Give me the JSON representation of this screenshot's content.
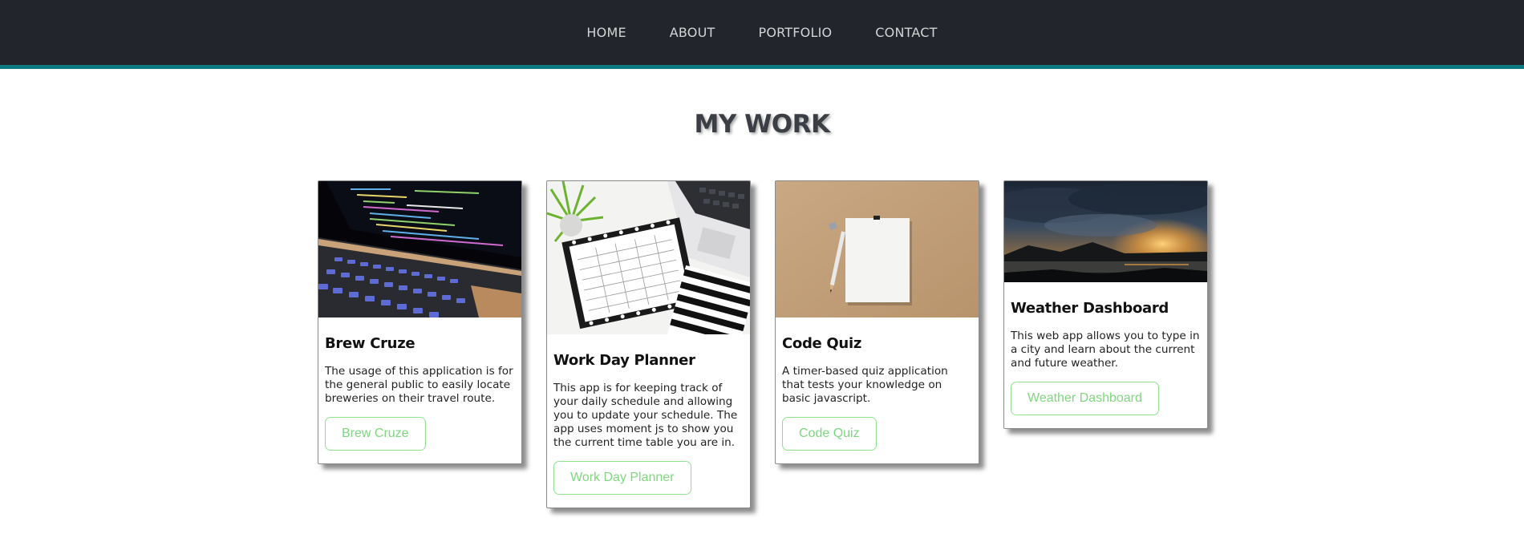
{
  "nav": {
    "items": [
      {
        "label": "HOME"
      },
      {
        "label": "ABOUT"
      },
      {
        "label": "PORTFOLIO"
      },
      {
        "label": "CONTACT"
      }
    ]
  },
  "section": {
    "title": "MY WORK"
  },
  "cards": [
    {
      "title": "Brew Cruze",
      "description": "The usage of this application is for the general public to easily locate breweries on their travel route.",
      "button_label": "Brew Cruze",
      "image": "laptop-code-photo"
    },
    {
      "title": "Work Day Planner",
      "description": "This app is for keeping track of your daily schedule and allowing you to update your schedule. The app uses moment js to show you the current time table you are in.",
      "button_label": "Work Day Planner",
      "image": "planner-desk-photo"
    },
    {
      "title": "Code Quiz",
      "description": "A timer-based quiz application that tests your knowledge on basic javascript.",
      "button_label": "Code Quiz",
      "image": "paper-pencil-photo"
    },
    {
      "title": "Weather Dashboard",
      "description": "This web app allows you to type in a city and learn about the current and future weather.",
      "button_label": "Weather Dashboard",
      "image": "storm-sunset-photo"
    }
  ],
  "colors": {
    "navbar_bg": "#22252c",
    "navbar_accent": "#0c7a80",
    "button_green": "#7ed77e"
  }
}
